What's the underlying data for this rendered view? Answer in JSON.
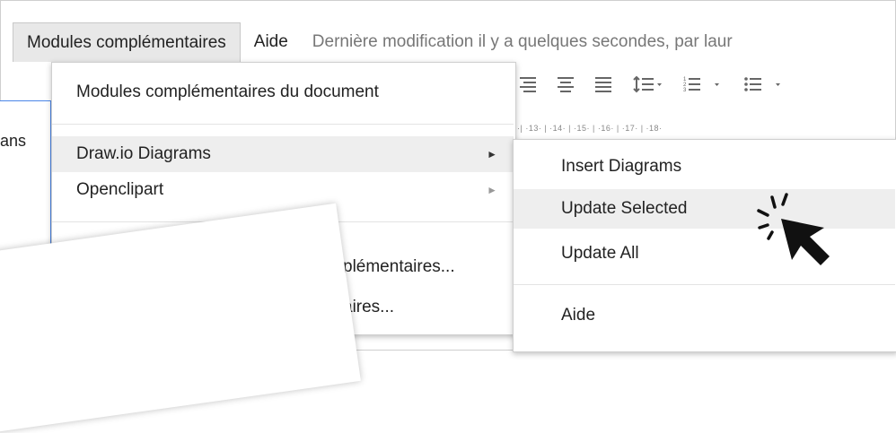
{
  "menubar": {
    "addons_label": "Modules complémentaires",
    "help_label": "Aide",
    "status_text": "Dernière modification il y a quelques secondes, par laur"
  },
  "hint": {
    "text_fragment": "ans"
  },
  "dropdown": {
    "items": [
      {
        "label": "Modules complémentaires du document"
      },
      {
        "label": "Draw.io Diagrams",
        "submenu_arrow": "►"
      },
      {
        "label": "Openclipart",
        "submenu_arrow": "►"
      },
      {
        "label": "plémentaires..."
      },
      {
        "label": "aires..."
      }
    ]
  },
  "ruler": {
    "text": "·| ·13· | ·14· | ·15· | ·16· | ·17· | ·18·"
  },
  "submenu": {
    "items": [
      {
        "label": "Insert Diagrams"
      },
      {
        "label": "Update Selected"
      },
      {
        "label": "Update All"
      },
      {
        "label": "Aide"
      }
    ]
  },
  "icons": [
    "align-right-icon",
    "align-center-icon",
    "align-justify-icon",
    "line-spacing-icon",
    "numbered-list-icon",
    "bulleted-list-icon",
    "cursor-click-icon"
  ],
  "colors": {
    "accent": "#4a86e8",
    "highlight": "#eeeeee",
    "menu_active": "#e8e8e8"
  }
}
